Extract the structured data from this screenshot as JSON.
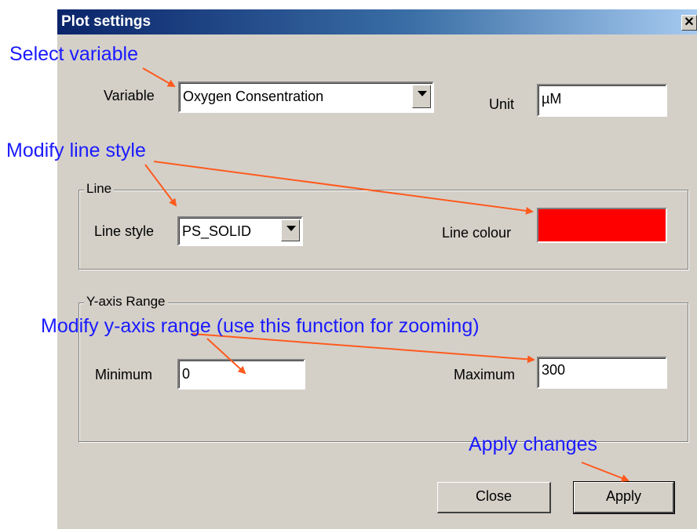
{
  "dialog": {
    "title": "Plot settings",
    "close_glyph": "✕"
  },
  "variable": {
    "label": "Variable",
    "value": "Oxygen Consentration"
  },
  "unit": {
    "label": "Unit",
    "value": "µM"
  },
  "line_group": {
    "title": "Line",
    "style_label": "Line style",
    "style_value": "PS_SOLID",
    "colour_label": "Line colour",
    "colour": "#ff0000"
  },
  "yaxis_group": {
    "title": "Y-axis Range",
    "min_label": "Minimum",
    "min_value": "0",
    "max_label": "Maximum",
    "max_value": "300"
  },
  "buttons": {
    "close": "Close",
    "apply": "Apply"
  },
  "annotations": {
    "select_variable": "Select variable",
    "modify_line_style": "Modify line style",
    "modify_yaxis": "Modify y-axis range (use this function for zooming)",
    "apply_changes": "Apply changes",
    "text_color": "#1a1aff",
    "arrow_color": "#ff5a1e"
  },
  "icons": {
    "dropdown": "chevron-down-icon",
    "close": "close-icon"
  }
}
